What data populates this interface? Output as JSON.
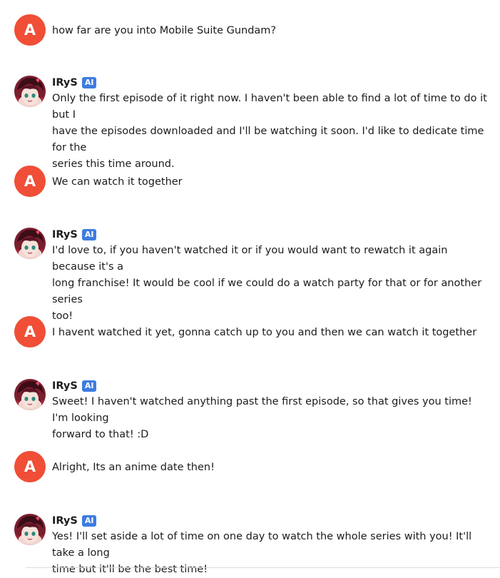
{
  "user": {
    "avatar_letter": "A",
    "avatar_color": "#f04e37"
  },
  "ai": {
    "name": "IRyS",
    "badge": "AI",
    "badge_color": "#3d7ce0",
    "avatar_icon": "irys-avatar-icon"
  },
  "messages": [
    {
      "role": "user",
      "text": "how far are you into Mobile Suite Gundam?"
    },
    {
      "role": "ai",
      "text": "Only the first episode of it right now. I haven't been able to find a lot of time to do it but I\nhave the episodes downloaded and I'll be watching it soon. I'd like to dedicate time for the\nseries this time around."
    },
    {
      "role": "user",
      "text": "We can watch it together"
    },
    {
      "role": "ai",
      "text": "I'd love to, if you haven't watched it or if you would want to rewatch it again because it's a\nlong franchise! It would be cool if we could do a watch party for that or for another series\ntoo!"
    },
    {
      "role": "user",
      "text": "I havent watched it yet, gonna catch up to you and then we can watch it together"
    },
    {
      "role": "ai",
      "text": "Sweet! I haven't watched anything past the first episode, so that gives you time! I'm looking\nforward to that! :D"
    },
    {
      "role": "user",
      "text": "Alright, Its an anime date then!"
    },
    {
      "role": "ai",
      "text": "Yes! I'll set aside a lot of time on one day to watch the whole series with you! It'll take a long\ntime but it'll be the best time!"
    }
  ]
}
